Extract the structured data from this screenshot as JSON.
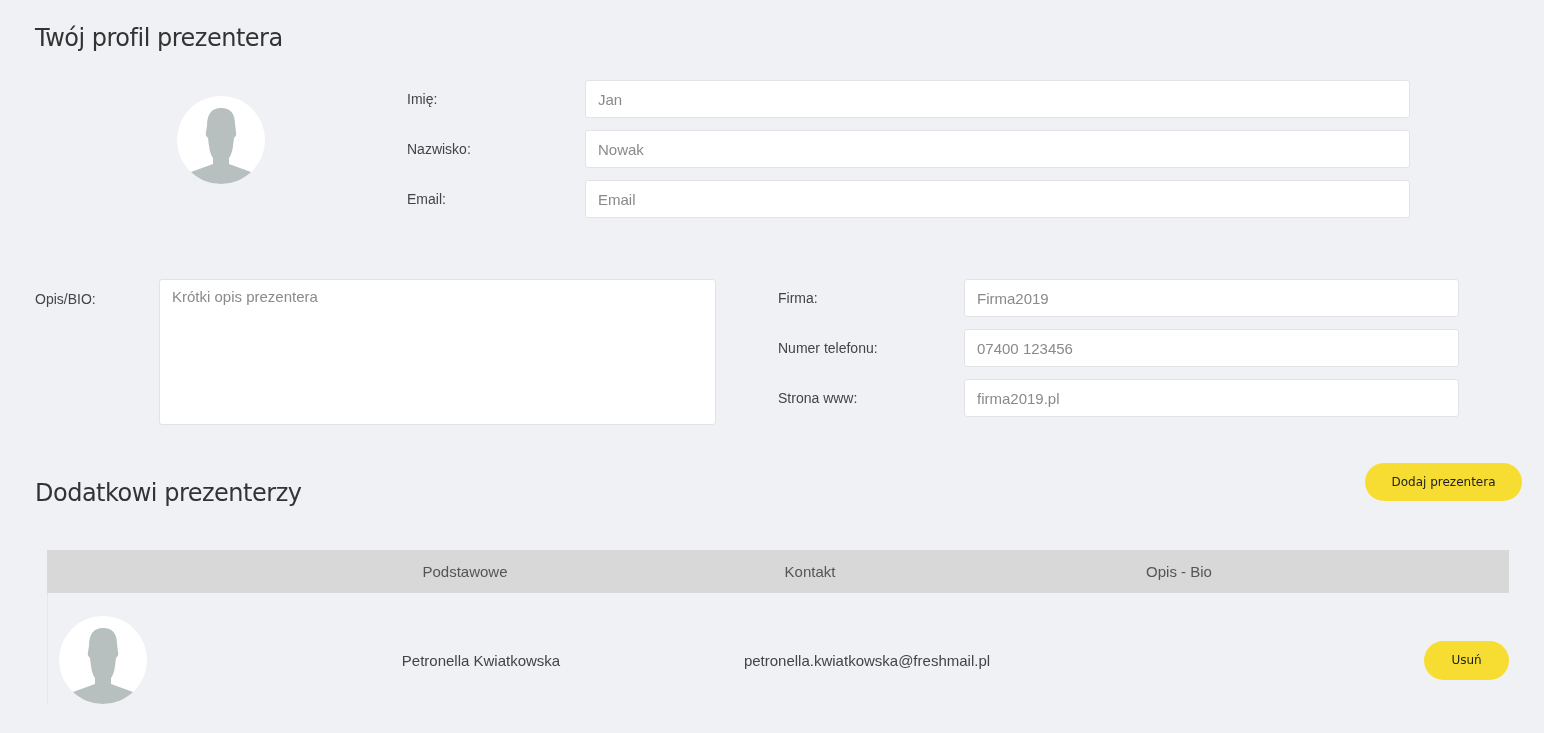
{
  "profile": {
    "title": "Twój profil prezentera",
    "fields": [
      {
        "label": "Imię:",
        "placeholder": "Jan"
      },
      {
        "label": "Nazwisko:",
        "placeholder": "Nowak"
      },
      {
        "label": "Email:",
        "placeholder": "Email"
      }
    ],
    "bio": {
      "label": "Opis/BIO:",
      "placeholder": "Krótki opis prezentera"
    },
    "contact_fields": [
      {
        "label": "Firma:",
        "placeholder": "Firma2019"
      },
      {
        "label": "Numer telefonu:",
        "placeholder": "07400 123456"
      },
      {
        "label": "Strona www:",
        "placeholder": "firma2019.pl"
      }
    ]
  },
  "presenters": {
    "title": "Dodatkowi prezenterzy",
    "add_button": "Dodaj prezentera",
    "table": {
      "columns": [
        "Podstawowe",
        "Kontakt",
        "Opis - Bio"
      ],
      "rows": [
        {
          "name": "Petronella Kwiatkowska",
          "email": "petronella.kwiatkowska@freshmail.pl",
          "button": "Usuń"
        }
      ]
    }
  }
}
